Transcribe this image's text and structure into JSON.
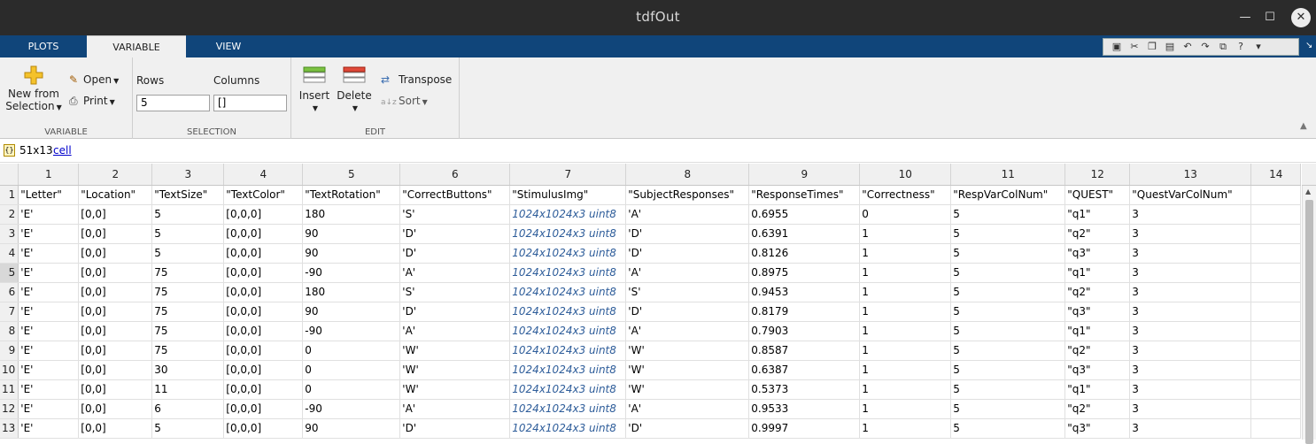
{
  "window": {
    "title": "tdfOut"
  },
  "tabs": [
    {
      "label": "PLOTS",
      "active": false
    },
    {
      "label": "VARIABLE",
      "active": true
    },
    {
      "label": "VIEW",
      "active": false
    }
  ],
  "toolstrip": {
    "new_from_selection_line1": "New from",
    "new_from_selection_line2": "Selection",
    "open": "Open",
    "print": "Print",
    "variable_group": "VARIABLE",
    "rows_label": "Rows",
    "columns_label": "Columns",
    "rows_value": "5",
    "columns_value": "[]",
    "selection_group": "SELECTION",
    "insert": "Insert",
    "delete": "Delete",
    "transpose": "Transpose",
    "sort": "Sort",
    "edit_group": "EDIT"
  },
  "variable": {
    "size": "51x13",
    "class": "cell"
  },
  "grid": {
    "column_headers": [
      "1",
      "2",
      "3",
      "4",
      "5",
      "6",
      "7",
      "8",
      "9",
      "10",
      "11",
      "12",
      "13",
      "14"
    ],
    "rows": [
      {
        "n": "1",
        "cells": [
          "\"Letter\"",
          "\"Location\"",
          "\"TextSize\"",
          "\"TextColor\"",
          "\"TextRotation\"",
          "\"CorrectButtons\"",
          "\"StimulusImg\"",
          "\"SubjectResponses\"",
          "\"ResponseTimes\"",
          "\"Correctness\"",
          "\"RespVarColNum\"",
          "\"QUEST\"",
          "\"QuestVarColNum\"",
          ""
        ]
      },
      {
        "n": "2",
        "cells": [
          "'E'",
          "[0,0]",
          "5",
          "[0,0,0]",
          "180",
          "'S'",
          "1024x1024x3 uint8",
          "'A'",
          "0.6955",
          "0",
          "5",
          "\"q1\"",
          "3",
          ""
        ]
      },
      {
        "n": "3",
        "cells": [
          "'E'",
          "[0,0]",
          "5",
          "[0,0,0]",
          "90",
          "'D'",
          "1024x1024x3 uint8",
          "'D'",
          "0.6391",
          "1",
          "5",
          "\"q2\"",
          "3",
          ""
        ]
      },
      {
        "n": "4",
        "cells": [
          "'E'",
          "[0,0]",
          "5",
          "[0,0,0]",
          "90",
          "'D'",
          "1024x1024x3 uint8",
          "'D'",
          "0.8126",
          "1",
          "5",
          "\"q3\"",
          "3",
          ""
        ]
      },
      {
        "n": "5",
        "cells": [
          "'E'",
          "[0,0]",
          "75",
          "[0,0,0]",
          "-90",
          "'A'",
          "1024x1024x3 uint8",
          "'A'",
          "0.8975",
          "1",
          "5",
          "\"q1\"",
          "3",
          ""
        ]
      },
      {
        "n": "6",
        "cells": [
          "'E'",
          "[0,0]",
          "75",
          "[0,0,0]",
          "180",
          "'S'",
          "1024x1024x3 uint8",
          "'S'",
          "0.9453",
          "1",
          "5",
          "\"q2\"",
          "3",
          ""
        ]
      },
      {
        "n": "7",
        "cells": [
          "'E'",
          "[0,0]",
          "75",
          "[0,0,0]",
          "90",
          "'D'",
          "1024x1024x3 uint8",
          "'D'",
          "0.8179",
          "1",
          "5",
          "\"q3\"",
          "3",
          ""
        ]
      },
      {
        "n": "8",
        "cells": [
          "'E'",
          "[0,0]",
          "75",
          "[0,0,0]",
          "-90",
          "'A'",
          "1024x1024x3 uint8",
          "'A'",
          "0.7903",
          "1",
          "5",
          "\"q1\"",
          "3",
          ""
        ]
      },
      {
        "n": "9",
        "cells": [
          "'E'",
          "[0,0]",
          "75",
          "[0,0,0]",
          "0",
          "'W'",
          "1024x1024x3 uint8",
          "'W'",
          "0.8587",
          "1",
          "5",
          "\"q2\"",
          "3",
          ""
        ]
      },
      {
        "n": "10",
        "cells": [
          "'E'",
          "[0,0]",
          "30",
          "[0,0,0]",
          "0",
          "'W'",
          "1024x1024x3 uint8",
          "'W'",
          "0.6387",
          "1",
          "5",
          "\"q3\"",
          "3",
          ""
        ]
      },
      {
        "n": "11",
        "cells": [
          "'E'",
          "[0,0]",
          "11",
          "[0,0,0]",
          "0",
          "'W'",
          "1024x1024x3 uint8",
          "'W'",
          "0.5373",
          "1",
          "5",
          "\"q1\"",
          "3",
          ""
        ]
      },
      {
        "n": "12",
        "cells": [
          "'E'",
          "[0,0]",
          "6",
          "[0,0,0]",
          "-90",
          "'A'",
          "1024x1024x3 uint8",
          "'A'",
          "0.9533",
          "1",
          "5",
          "\"q2\"",
          "3",
          ""
        ]
      },
      {
        "n": "13",
        "cells": [
          "'E'",
          "[0,0]",
          "5",
          "[0,0,0]",
          "90",
          "'D'",
          "1024x1024x3 uint8",
          "'D'",
          "0.9997",
          "1",
          "5",
          "\"q3\"",
          "3",
          ""
        ]
      }
    ],
    "selected_row": "5"
  },
  "colors": {
    "tab_bar": "#10457a",
    "title_bar": "#2b2b2b",
    "image_cell": "#2e5d9a"
  }
}
